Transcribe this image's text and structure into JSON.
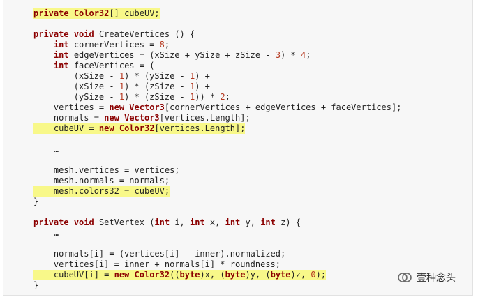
{
  "code_lines": [
    {
      "text": "private Color32[] cubeUV;",
      "highlight": true
    },
    {
      "text": "",
      "highlight": false
    },
    {
      "text": "private void CreateVertices () {",
      "highlight": false
    },
    {
      "text": "    int cornerVertices = 8;",
      "highlight": false
    },
    {
      "text": "    int edgeVertices = (xSize + ySize + zSize - 3) * 4;",
      "highlight": false
    },
    {
      "text": "    int faceVertices = (",
      "highlight": false
    },
    {
      "text": "        (xSize - 1) * (ySize - 1) +",
      "highlight": false
    },
    {
      "text": "        (xSize - 1) * (zSize - 1) +",
      "highlight": false
    },
    {
      "text": "        (ySize - 1) * (zSize - 1)) * 2;",
      "highlight": false
    },
    {
      "text": "    vertices = new Vector3[cornerVertices + edgeVertices + faceVertices];",
      "highlight": false
    },
    {
      "text": "    normals = new Vector3[vertices.Length];",
      "highlight": false
    },
    {
      "text": "    cubeUV = new Color32[vertices.Length];",
      "highlight": true
    },
    {
      "text": "",
      "highlight": false
    },
    {
      "text": "    …",
      "highlight": false
    },
    {
      "text": "",
      "highlight": false
    },
    {
      "text": "    mesh.vertices = vertices;",
      "highlight": false
    },
    {
      "text": "    mesh.normals = normals;",
      "highlight": false
    },
    {
      "text": "    mesh.colors32 = cubeUV;",
      "highlight": true
    },
    {
      "text": "}",
      "highlight": false
    },
    {
      "text": "",
      "highlight": false
    },
    {
      "text": "private void SetVertex (int i, int x, int y, int z) {",
      "highlight": false
    },
    {
      "text": "    …",
      "highlight": false
    },
    {
      "text": "",
      "highlight": false
    },
    {
      "text": "    normals[i] = (vertices[i] - inner).normalized;",
      "highlight": false
    },
    {
      "text": "    vertices[i] = inner + normals[i] * roundness;",
      "highlight": false
    },
    {
      "text": "    cubeUV[i] = new Color32((byte)x, (byte)y, (byte)z, 0);",
      "highlight": true
    },
    {
      "text": "}",
      "highlight": false
    }
  ],
  "keywords": [
    "private",
    "void",
    "int",
    "new",
    "byte",
    "Color32",
    "Vector3"
  ],
  "colors": {
    "keyword": "#8b0000",
    "number": "#b5381f",
    "highlight": "#f8f889",
    "text": "#222222",
    "panel": "#f7f7f7"
  },
  "watermark": {
    "icon": "wechat-channel-icon",
    "text": "壹种念头"
  }
}
